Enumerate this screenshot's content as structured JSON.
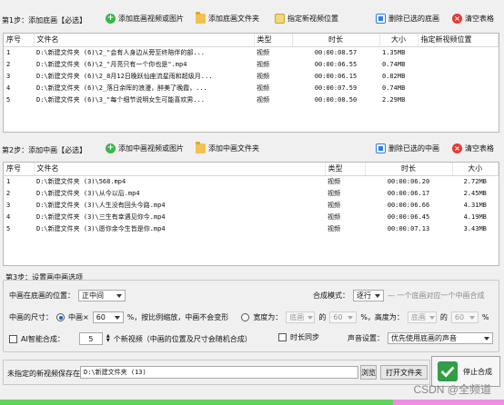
{
  "step1": {
    "label": "第1步：添加底画【必选】",
    "add_video_btn": "添加底画视频或图片",
    "add_folder_btn": "添加底画文件夹",
    "set_position_btn": "指定新视频位置",
    "delete_selected_btn": "删除已选的底画",
    "clear_btn": "清空表格",
    "headers": [
      "序号",
      "文件名",
      "类型",
      "时长",
      "大小",
      "指定新视频位置"
    ],
    "rows": [
      {
        "no": "1",
        "name": "D:\\新建文件夹 (6)\\2_\"会有人身边从旁至终陪伴的部...",
        "type": "视频",
        "duration": "00:00:08.57",
        "size": "1.35MB",
        "pos": ""
      },
      {
        "no": "2",
        "name": "D:\\新建文件夹 (6)\\2_\"月亮只有一个你也是\".mp4",
        "type": "视频",
        "duration": "00:00:06.55",
        "size": "0.74MB",
        "pos": ""
      },
      {
        "no": "3",
        "name": "D:\\新建文件夹 (6)\\2_8月12日晚跃仙座流星雨和超级月...",
        "type": "视频",
        "duration": "00:00:06.15",
        "size": "0.82MB",
        "pos": ""
      },
      {
        "no": "4",
        "name": "D:\\新建文件夹 (6)\\2_落日余晖的浪漫，醉美了晚霞，...",
        "type": "视频",
        "duration": "00:00:07.59",
        "size": "0.74MB",
        "pos": ""
      },
      {
        "no": "5",
        "name": "D:\\新建文件夹 (6)\\3_\"每个细节说明女生可能喜欢男...",
        "type": "视频",
        "duration": "00:00:08.50",
        "size": "2.29MB",
        "pos": ""
      }
    ]
  },
  "step2": {
    "label": "第2步：添加中画【必选】",
    "add_video_btn": "添加中画视频或图片",
    "add_folder_btn": "添加中画文件夹",
    "delete_selected_btn": "删除已选的中画",
    "clear_btn": "清空表格",
    "headers": [
      "序号",
      "文件名",
      "类型",
      "时长",
      "大小"
    ],
    "rows": [
      {
        "no": "1",
        "name": "D:\\新建文件夹 (3)\\568.mp4",
        "type": "视频",
        "duration": "00:00:06.20",
        "size": "2.72MB"
      },
      {
        "no": "2",
        "name": "D:\\新建文件夹 (3)\\从今以后.mp4",
        "type": "视频",
        "duration": "00:00:06.17",
        "size": "2.45MB"
      },
      {
        "no": "3",
        "name": "D:\\新建文件夹 (3)\\人生没有回头今路.mp4",
        "type": "视频",
        "duration": "00:00:06.66",
        "size": "4.31MB"
      },
      {
        "no": "4",
        "name": "D:\\新建文件夹 (3)\\三生有幸遇见你今.mp4",
        "type": "视频",
        "duration": "00:00:06.45",
        "size": "4.19MB"
      },
      {
        "no": "5",
        "name": "D:\\新建文件夹 (3)\\愿你余今生皆是你.mp4",
        "type": "视频",
        "duration": "00:00:07.13",
        "size": "3.43MB"
      }
    ]
  },
  "step3": {
    "label": "第3步：设置画中画选项",
    "position_label": "中画在底画的位置：",
    "position_value": "正中间",
    "blend_label": "合成模式：",
    "blend_value": "逐行",
    "blend_hint": "一个底画对应一个中画合成",
    "size_label": "中画的尺寸：",
    "size_mode1": "中画×",
    "size_value": "60",
    "size_tail": "%，按比例缩放，中画不会变形",
    "size_mode2": "宽度为：",
    "width_ref": "底画",
    "of1": "的",
    "width_pct": "60",
    "height_label": "%，高度为：",
    "height_ref": "底画",
    "of2": "的",
    "height_pct": "60",
    "pct": "%",
    "ai_label": "AI智能合成：",
    "ai_count": "5",
    "ai_tail": "个新视频（中画的位置及尺寸会随机合成）",
    "time_sync_label": "时长同步",
    "audio_label": "声音设置：",
    "audio_value": "优先使用底画的声音"
  },
  "output": {
    "label": "未指定的新视频保存在：",
    "path": "D:\\新建文件夹 (13)",
    "browse_btn": "浏览",
    "open_btn": "打开文件夹",
    "stop_btn": "停止合成"
  },
  "watermark": "CSDN @全频道",
  "progress": {
    "green_fraction": 0.78
  },
  "colors": {
    "accent_blue": "#1a5fb4",
    "progress_green": "#60d35a",
    "progress_pink": "#f28be6",
    "clear_red": "#e53935",
    "add_green": "#3bb54a"
  }
}
